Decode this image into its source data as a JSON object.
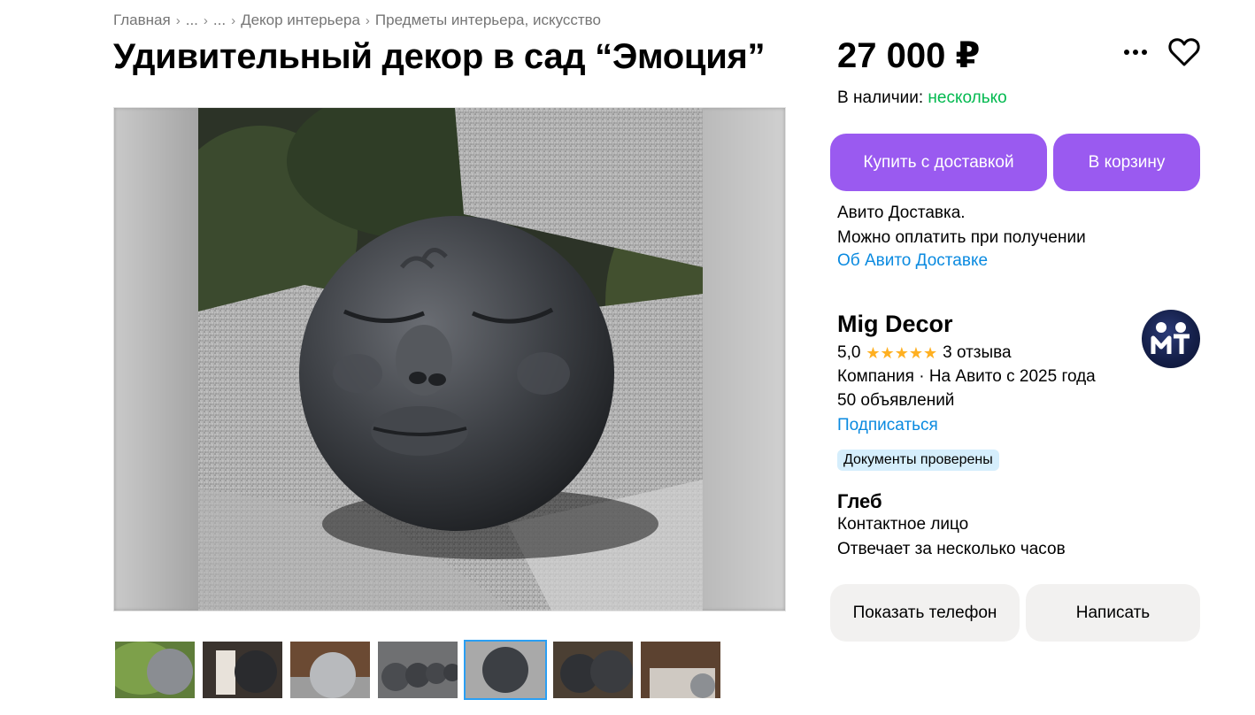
{
  "breadcrumb": {
    "items": [
      "Главная",
      "...",
      "...",
      "Декор интерьера",
      "Предметы интерьера, искусство"
    ],
    "separator": "›"
  },
  "listing": {
    "title": "Удивительный декор в сад “Эмоция”",
    "price": "27 000 ₽",
    "availability_label": "В наличии:",
    "availability_value": "несколько"
  },
  "actions": {
    "buy_label": "Купить с доставкой",
    "cart_label": "В корзину",
    "more_icon": "more-dots-icon",
    "favorite_icon": "heart-icon"
  },
  "delivery": {
    "line1": "Авито Доставка.",
    "line2": "Можно оплатить при получении",
    "link": "Об Авито Доставке"
  },
  "seller": {
    "name": "Mig Decor",
    "rating": "5,0",
    "stars": "★★★★★",
    "reviews": "3 отзыва",
    "info": "Компания · На Авито с 2025 года",
    "ads": "50 объявлений",
    "subscribe": "Подписаться",
    "badge": "Документы проверены"
  },
  "contact": {
    "name": "Глеб",
    "role": "Контактное лицо",
    "response": "Отвечает за несколько часов"
  },
  "contact_actions": {
    "phone_label": "Показать телефон",
    "message_label": "Написать"
  },
  "gallery": {
    "thumb_count": 7,
    "active_thumb": 5
  },
  "colors": {
    "accent_purple": "#9a5af0",
    "in_stock_green": "#02b94f",
    "link_blue": "#0a8ae0",
    "star_gold": "#ffb021",
    "badge_blue": "#d5eefc"
  }
}
